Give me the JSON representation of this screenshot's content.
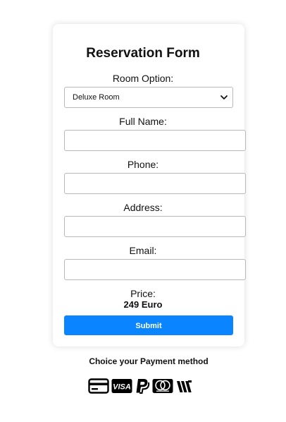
{
  "form": {
    "title": "Reservation Form",
    "room_label": "Room Option:",
    "room_value": "Deluxe Room",
    "fullname_label": "Full Name:",
    "fullname_value": "",
    "phone_label": "Phone:",
    "phone_value": "",
    "address_label": "Address:",
    "address_value": "",
    "email_label": "Email:",
    "email_value": "",
    "price_label": "Price:",
    "price_value": "249 Euro",
    "submit_label": "Submit"
  },
  "payment": {
    "heading": "Choice your Payment method",
    "icons": [
      "credit-card-icon",
      "visa-icon",
      "paypal-icon",
      "mastercard-icon",
      "wallet-icon"
    ]
  },
  "colors": {
    "accent": "#0a84ff"
  }
}
